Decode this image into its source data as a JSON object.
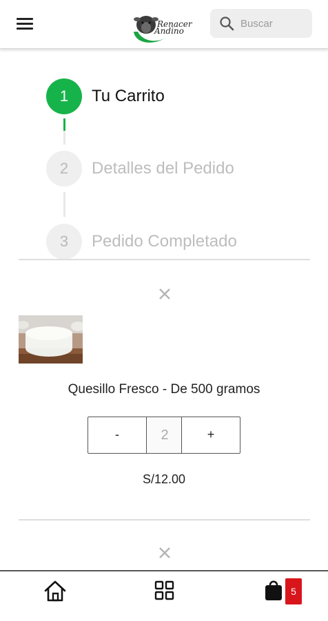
{
  "header": {
    "logo_text_line1": "Renacer",
    "logo_text_line2": "Andino",
    "search_placeholder": "Buscar"
  },
  "steps": [
    {
      "number": "1",
      "label": "Tu Carrito",
      "state": "active"
    },
    {
      "number": "2",
      "label": "Detalles del Pedido",
      "state": "inactive"
    },
    {
      "number": "3",
      "label": "Pedido Completado",
      "state": "inactive"
    }
  ],
  "cart": {
    "items": [
      {
        "name": "Quesillo Fresco - De 500 gramos",
        "quantity": "2",
        "minus_label": "-",
        "plus_label": "+",
        "price": "S/12.00"
      }
    ]
  },
  "bottom_nav": {
    "cart_count": "5"
  },
  "colors": {
    "accent_green": "#16b34a",
    "badge_red": "#d9151c"
  },
  "icons": [
    "menu-icon",
    "search-icon",
    "close-icon",
    "home-icon",
    "grid-icon",
    "shopping-bag-icon"
  ]
}
